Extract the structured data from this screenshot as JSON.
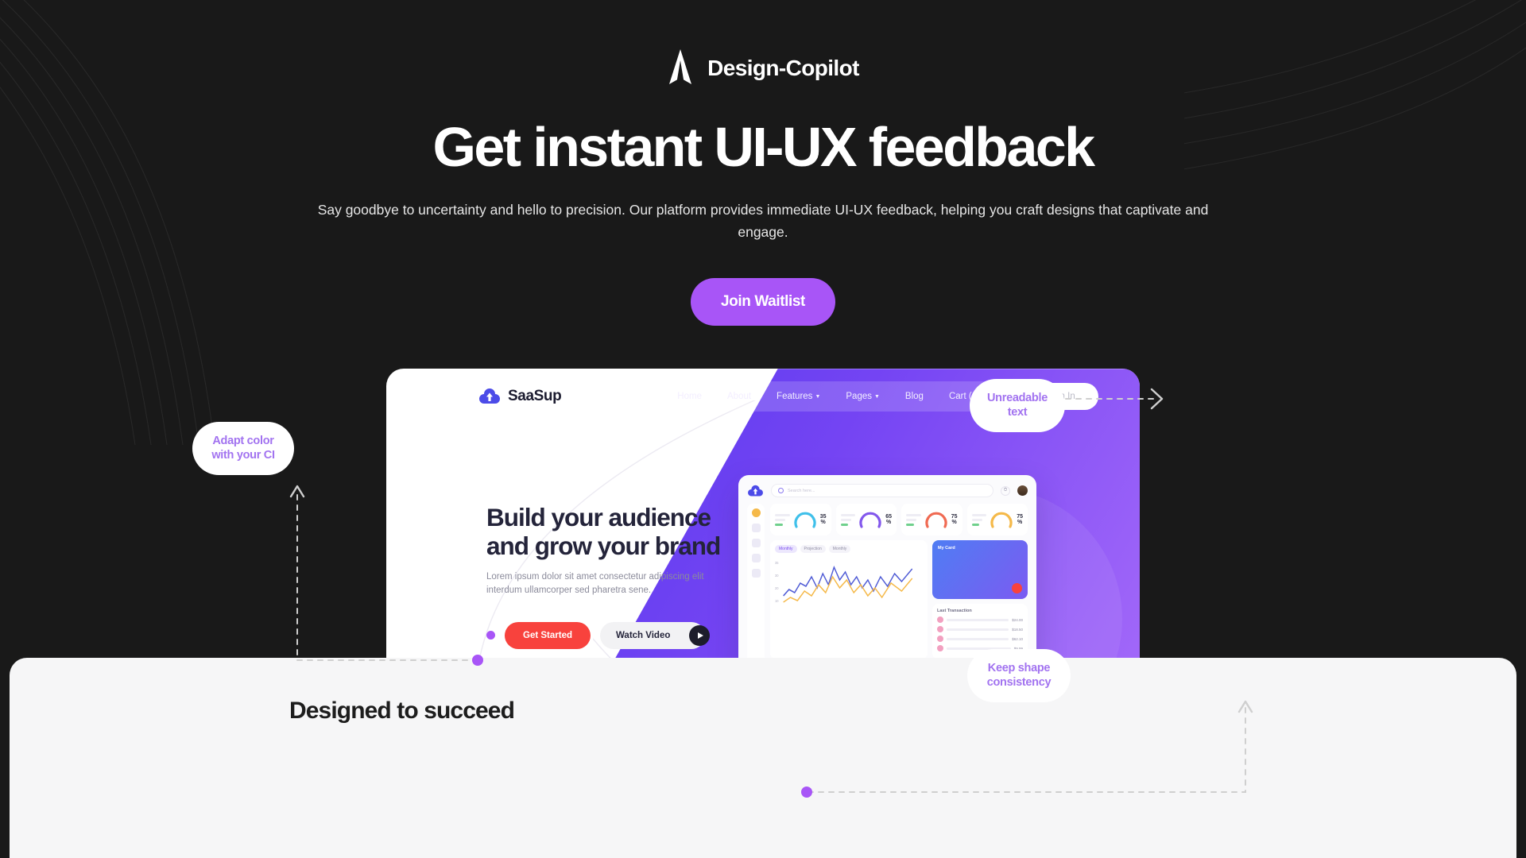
{
  "brand": {
    "name": "Design-Copilot",
    "logo_icon": "arrowhead-spear-icon"
  },
  "hero": {
    "headline": "Get instant UI-UX feedback",
    "subheadline": "Say goodbye to uncertainty and hello to precision. Our platform provides immediate UI-UX feedback, helping you craft designs that captivate and engage.",
    "cta_label": "Join Waitlist",
    "cta_color": "#a855f7"
  },
  "mockup": {
    "logo_text": "SaaSup",
    "logo_icon": "cloud-upload-icon",
    "nav": [
      {
        "label": "Home",
        "has_caret": false
      },
      {
        "label": "About",
        "has_caret": false
      },
      {
        "label": "Features",
        "has_caret": true
      },
      {
        "label": "Pages",
        "has_caret": true
      },
      {
        "label": "Blog",
        "has_caret": false
      },
      {
        "label": "Cart (0)",
        "has_caret": false
      }
    ],
    "signin_label": "Sign In",
    "hero_title": "Build your audience and grow your brand",
    "hero_paragraph": "Lorem ipsum dolor sit amet consectetur adipiscing elit interdum ullamcorper sed pharetra sene.",
    "primary_button": "Get Started",
    "primary_button_color": "#F8423D",
    "secondary_button": "Watch Video",
    "play_icon": "play-icon",
    "features_pill": "Features"
  },
  "dashboard": {
    "search_placeholder": "Search here...",
    "gauges": [
      {
        "value": "35",
        "unit": "%",
        "color": "#3FC0EA"
      },
      {
        "value": "65",
        "unit": "%",
        "color": "#8257EC"
      },
      {
        "value": "75",
        "unit": "%",
        "color": "#F06A52"
      },
      {
        "value": "75",
        "unit": "%",
        "color": "#F5B949"
      }
    ],
    "chips": [
      {
        "label": "Monthly",
        "active": true
      },
      {
        "label": "Projection",
        "active": false
      },
      {
        "label": "Monthly",
        "active": false
      }
    ],
    "y_ticks": [
      "35",
      "30",
      "20",
      "10"
    ],
    "card_title": "My Card",
    "transactions_title": "Last Transaction",
    "transactions": [
      {
        "amount": "$24.00"
      },
      {
        "amount": "$18.50"
      },
      {
        "amount": "$62.10"
      },
      {
        "amount": "$9.99"
      }
    ]
  },
  "annotations": [
    {
      "id": "adapt",
      "text": "Adapt color with your CI"
    },
    {
      "id": "unread",
      "text": "Unreadable text"
    },
    {
      "id": "shape",
      "text": "Keep shape consistency"
    }
  ],
  "bottom_section": {
    "title": "Designed to succeed"
  },
  "colors": {
    "page_bg": "#191919",
    "accent_purple": "#a855f7",
    "callout_text": "#a273f0",
    "mock_purple_start": "#5B3BEF",
    "mock_purple_end": "#A167F9",
    "bottom_bg": "#f6f6f7"
  }
}
